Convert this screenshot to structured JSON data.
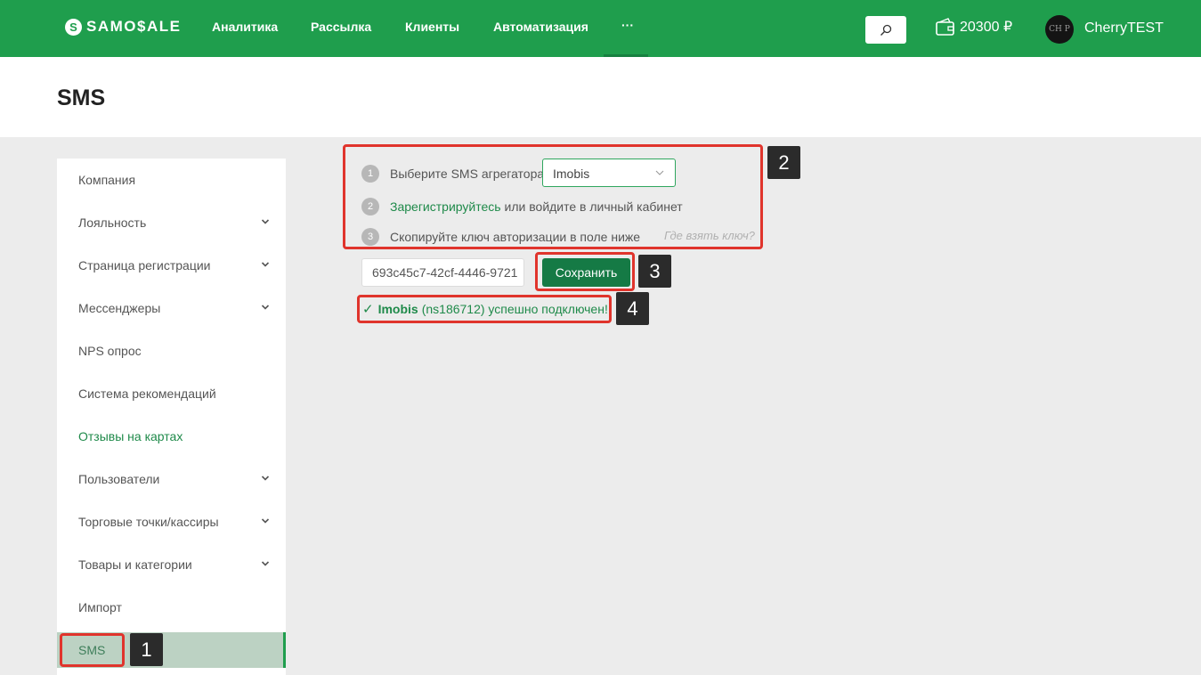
{
  "header": {
    "logo_mark": "S",
    "logo_text": "SAMO$ALE",
    "nav": [
      {
        "label": "Аналитика"
      },
      {
        "label": "Рассылка"
      },
      {
        "label": "Клиенты"
      },
      {
        "label": "Автоматизация"
      },
      {
        "label": "···"
      }
    ],
    "balance": "20300 ₽",
    "avatar_text": "CH P",
    "username": "CherryTEST"
  },
  "page": {
    "title": "SMS"
  },
  "sidebar": {
    "items": [
      {
        "label": "Компания"
      },
      {
        "label": "Лояльность"
      },
      {
        "label": "Страница регистрации"
      },
      {
        "label": "Мессенджеры"
      },
      {
        "label": "NPS опрос"
      },
      {
        "label": "Система рекомендаций"
      },
      {
        "label": "Отзывы на картах"
      },
      {
        "label": "Пользователи"
      },
      {
        "label": "Торговые точки/кассиры"
      },
      {
        "label": "Товары и категории"
      },
      {
        "label": "Импорт"
      },
      {
        "label": "SMS"
      }
    ]
  },
  "steps": {
    "step1": {
      "num": "1",
      "label": "Выберите SMS агрегатора",
      "selected": "Imobis"
    },
    "step2": {
      "num": "2",
      "link": "Зарегистрируйтесь",
      "rest": "или войдите в личный кабинет"
    },
    "step3": {
      "num": "3",
      "label": "Скопируйте ключ авторизации в поле ниже",
      "hint": "Где взять ключ?"
    }
  },
  "form": {
    "key_value": "693c45c7-42cf-4446-9721",
    "save_label": "Сохранить"
  },
  "status": {
    "check": "✓",
    "provider": "Imobis",
    "message": "(ns186712) успешно подключен!"
  },
  "annotations": [
    "1",
    "2",
    "3",
    "4"
  ],
  "colors": {
    "brand_green": "#1f9e4d",
    "button_green": "#157a45",
    "annotation_red": "#e0342c",
    "active_bg": "#bcd2c3"
  }
}
